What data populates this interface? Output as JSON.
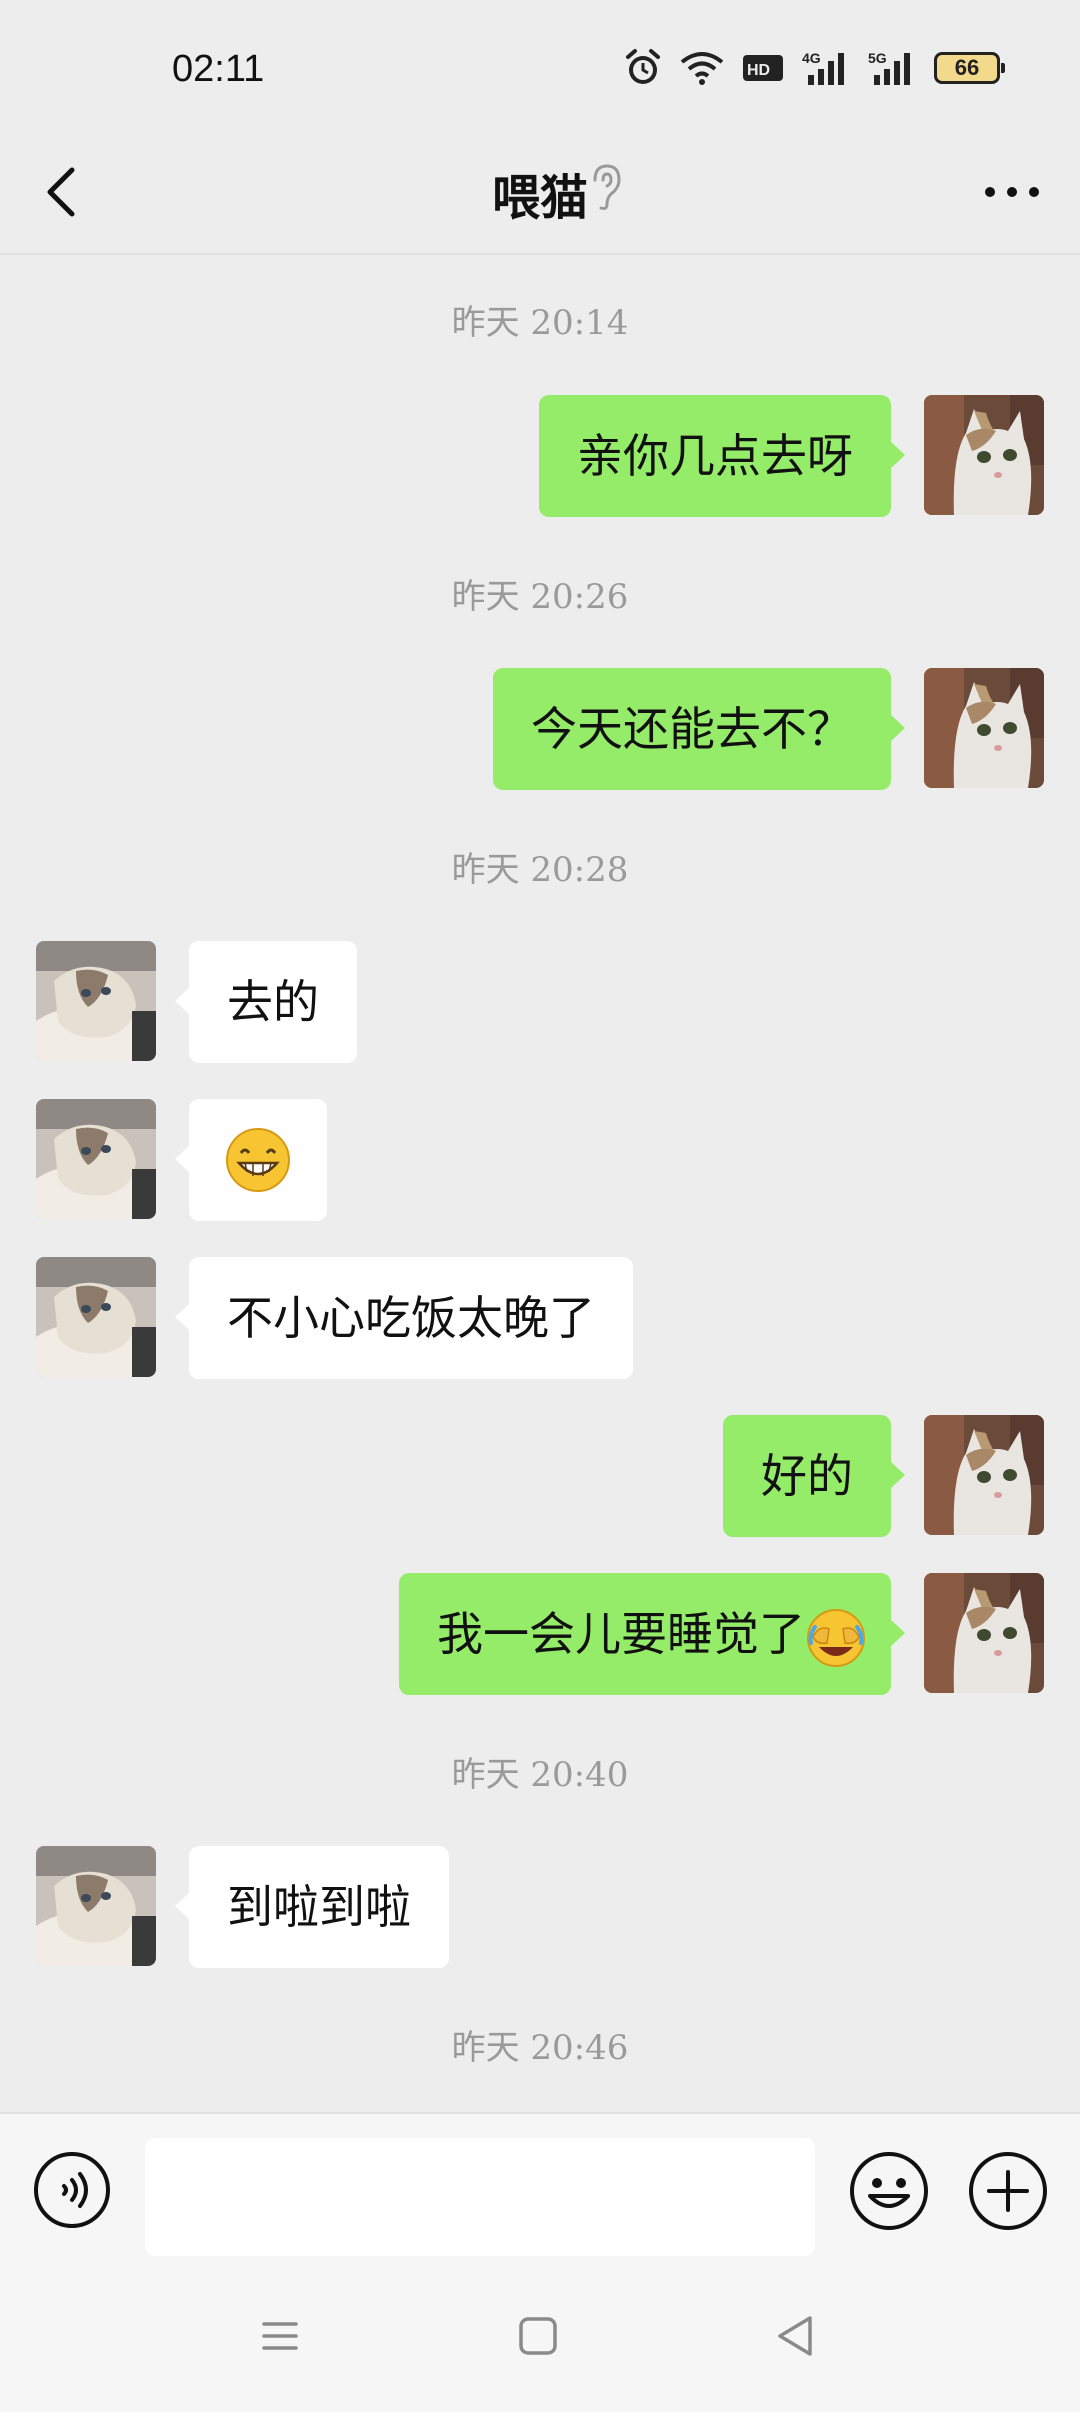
{
  "status_bar": {
    "time": "02:11",
    "icons": [
      "alarm-icon",
      "wifi-icon",
      "hd-icon",
      "4g-signal-icon",
      "5g-signal-icon"
    ],
    "battery": "66"
  },
  "header": {
    "title": "喂猫",
    "icons": [
      "back-icon",
      "ear-icon",
      "more-icon"
    ]
  },
  "messages": [
    {
      "type": "time",
      "text": "昨天 20:14"
    },
    {
      "type": "me",
      "text": "亲你几点去呀"
    },
    {
      "type": "time",
      "text": "昨天 20:26"
    },
    {
      "type": "me",
      "text": "今天还能去不？"
    },
    {
      "type": "time",
      "text": "昨天 20:28"
    },
    {
      "type": "them",
      "text": "去的"
    },
    {
      "type": "them",
      "emoji": "grinning-emoji"
    },
    {
      "type": "them",
      "text": "不小心吃饭太晚了"
    },
    {
      "type": "me",
      "text": "好的"
    },
    {
      "type": "me",
      "text": "我一会儿要睡觉了",
      "emoji": "laugh-cry-emoji"
    },
    {
      "type": "time",
      "text": "昨天 20:40"
    },
    {
      "type": "them",
      "text": "到啦到啦"
    },
    {
      "type": "time",
      "text": "昨天 20:46"
    }
  ],
  "input_bar": {
    "value": "",
    "icons": [
      "voice-icon",
      "emoji-icon",
      "plus-icon"
    ]
  },
  "system_nav": {
    "icons": [
      "menu-icon",
      "home-icon",
      "back-triangle-icon"
    ]
  },
  "colors": {
    "background": "#ededed",
    "my_bubble": "#95ec69",
    "their_bubble": "#ffffff",
    "timestamp": "#9a9a9a"
  }
}
